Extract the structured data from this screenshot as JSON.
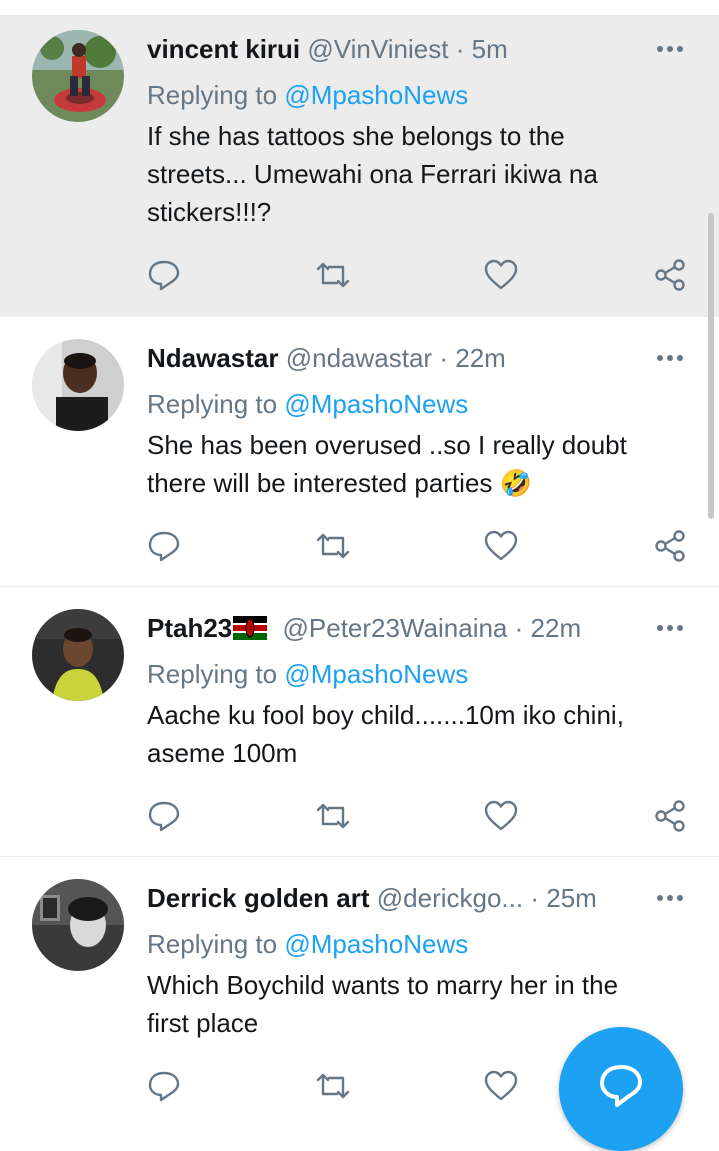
{
  "tweets": [
    {
      "name": "vincent kirui",
      "handle": "@VinViniest",
      "separator": "·",
      "time": "5m",
      "replying_prefix": "Replying to",
      "replying_mention": "@MpashoNews",
      "text_lines": [
        "If she has tattoos she belongs to the",
        "streets... Umewahi ona Ferrari ikiwa na",
        "stickers!!!?"
      ]
    },
    {
      "name": "Ndawastar",
      "handle": "@ndawastar",
      "separator": "·",
      "time": "22m",
      "replying_prefix": "Replying to",
      "replying_mention": "@MpashoNews",
      "text_lines": [
        "She has been overused ..so I really doubt",
        "there will be interested parties 🤣"
      ]
    },
    {
      "name": "Ptah23",
      "flag": "kenya-flag",
      "handle": "@Peter23Wainaina",
      "separator": "·",
      "time": "22m",
      "replying_prefix": "Replying to",
      "replying_mention": "@MpashoNews",
      "text_lines": [
        "Aache ku fool boy child.......10m iko chini,",
        "aseme 100m"
      ]
    },
    {
      "name": "Derrick golden art",
      "handle": "@derickgo...",
      "separator": "·",
      "time": "25m",
      "replying_prefix": "Replying to",
      "replying_mention": "@MpashoNews",
      "text_lines": [
        "Which Boychild wants to marry her in the",
        "first place"
      ]
    }
  ],
  "icons": {
    "reply": "reply-icon",
    "retweet": "retweet-icon",
    "like": "heart-icon",
    "share": "share-icon",
    "more": "more-dots-icon",
    "compose": "compose-icon"
  },
  "colors": {
    "accent": "#1da1f2",
    "muted": "#657786",
    "highlight_bg": "#ececec"
  }
}
